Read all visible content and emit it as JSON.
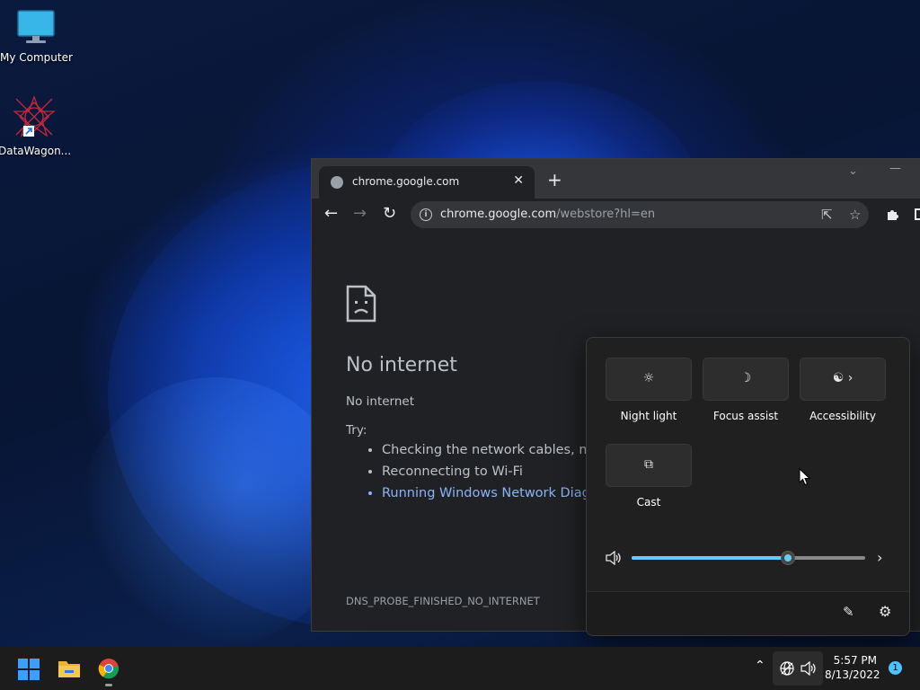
{
  "desktop": {
    "icons": [
      {
        "label": "My Computer",
        "icon": "monitor-icon"
      },
      {
        "label": "DataWagon...",
        "icon": "datawagon-icon"
      }
    ]
  },
  "chrome": {
    "tab_title": "chrome.google.com",
    "tab_close": "✕",
    "new_tab": "+",
    "url_host": "chrome.google.com",
    "url_path": "/webstore?hl=en",
    "error": {
      "heading": "No internet",
      "message": "No internet",
      "try_label": "Try:",
      "suggestions": [
        "Checking the network cables, modem, and router",
        "Reconnecting to Wi-Fi",
        "Running Windows Network Diagnostics"
      ],
      "code": "DNS_PROBE_FINISHED_NO_INTERNET"
    }
  },
  "quick_settings": {
    "tiles": [
      {
        "label": "Night light",
        "icon": "night-light-icon"
      },
      {
        "label": "Focus assist",
        "icon": "moon-icon"
      },
      {
        "label": "Accessibility",
        "icon": "accessibility-icon"
      },
      {
        "label": "Cast",
        "icon": "cast-icon"
      }
    ],
    "volume_level": 0.67,
    "accent": "#60cdff"
  },
  "taskbar": {
    "time": "5:57 PM",
    "date": "8/13/2022",
    "notification_count": "1",
    "accent": "#0067c0"
  }
}
